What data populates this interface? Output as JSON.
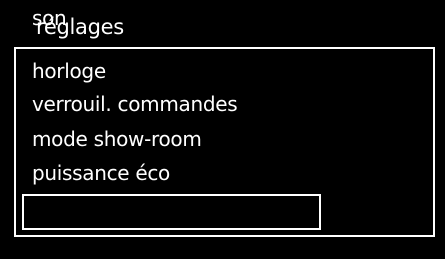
{
  "screen": {
    "title": "réglages"
  },
  "menu": {
    "items": [
      {
        "label": "horloge"
      },
      {
        "label": "verrouil. commandes"
      },
      {
        "label": "mode show-room"
      },
      {
        "label": "puissance éco"
      },
      {
        "label": "son"
      }
    ],
    "selected_label": "son"
  },
  "colors": {
    "background": "#000000",
    "foreground": "#ffffff"
  }
}
